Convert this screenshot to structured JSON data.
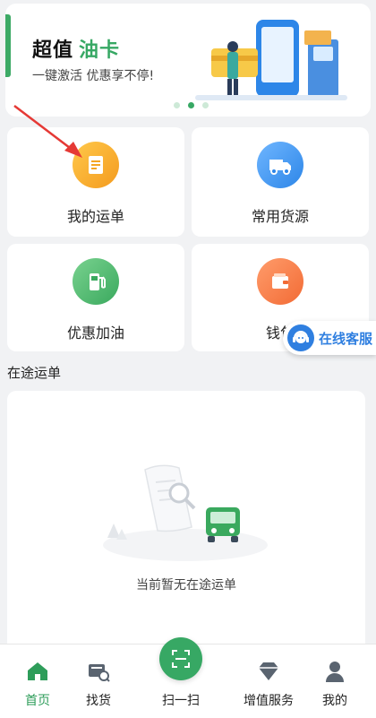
{
  "banner": {
    "title": "超值",
    "title_accent": "油卡",
    "subtitle": "一键激活 优惠享不停!",
    "slide_count": 3,
    "active_slide": 1
  },
  "quick_actions": [
    {
      "label": "我的运单",
      "icon": "document-icon",
      "color": "#f5a623"
    },
    {
      "label": "常用货源",
      "icon": "truck-icon",
      "color": "#2d86e8"
    },
    {
      "label": "优惠加油",
      "icon": "fuel-pump-icon",
      "color": "#3aa95e"
    },
    {
      "label": "钱包",
      "icon": "wallet-icon",
      "color": "#f26b35"
    }
  ],
  "customer_service": {
    "label": "在线客服",
    "icon": "headset-icon"
  },
  "in_transit": {
    "section_title": "在途运单",
    "empty_text": "当前暂无在途运单"
  },
  "tabbar": {
    "items": [
      {
        "label": "首页",
        "icon": "home-icon",
        "active": true
      },
      {
        "label": "找货",
        "icon": "search-goods-icon",
        "active": false
      },
      {
        "label": "扫一扫",
        "icon": "scan-icon",
        "active": false
      },
      {
        "label": "增值服务",
        "icon": "diamond-icon",
        "active": false
      },
      {
        "label": "我的",
        "icon": "user-icon",
        "active": false
      }
    ]
  },
  "colors": {
    "brand": "#37a864",
    "service": "#2f7fe0",
    "arrow": "#e53935"
  }
}
